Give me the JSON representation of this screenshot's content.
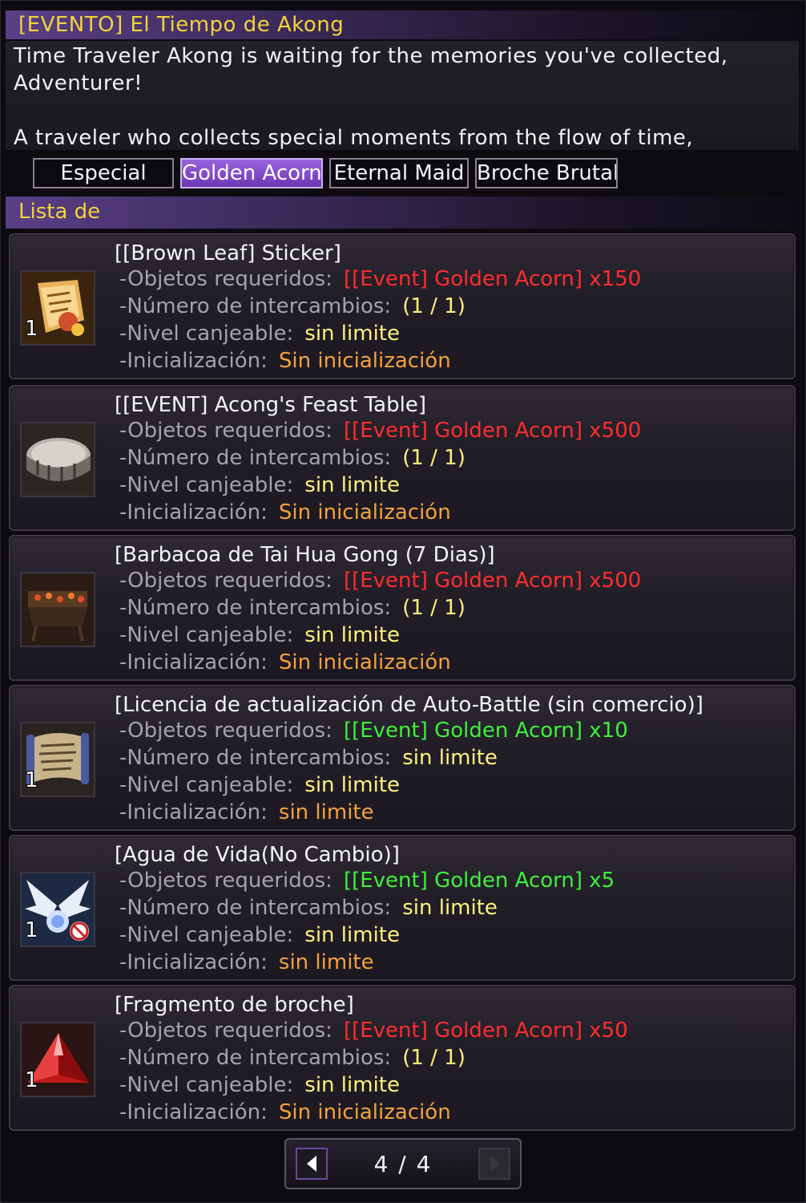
{
  "window": {
    "title": "[EVENTO] El Tiempo de Akong"
  },
  "description": {
    "line1": "Time Traveler Akong is waiting for the memories you've collected,",
    "line2": "Adventurer!",
    "line3": "",
    "line4": "A traveler who collects special moments from the flow of time,"
  },
  "tabs": [
    {
      "label": "Especial",
      "active": false
    },
    {
      "label": "Golden Acorn",
      "active": true
    },
    {
      "label": "Eternal Maid",
      "active": false
    },
    {
      "label": "Broche Brutal",
      "active": false
    }
  ],
  "list_header": "Lista de",
  "labels": {
    "required": "-Objetos requeridos:",
    "exchanges": "-Número de intercambios:",
    "level": "-Nivel canjeable:",
    "reset": "-Inicialización:"
  },
  "items": [
    {
      "name": "[[Brown Leaf] Sticker]",
      "icon": "scroll-sticker-icon",
      "qty": "1",
      "required": "[[Event] Golden Acorn] x150",
      "required_color": "#ff2d2d",
      "exchanges": "(1 / 1)",
      "level": "sin limite",
      "reset": "Sin inicialización"
    },
    {
      "name": "[[EVENT] Acong's Feast Table]",
      "icon": "feast-table-icon",
      "qty": "",
      "required": "[[Event] Golden Acorn] x500",
      "required_color": "#ff2d2d",
      "exchanges": "(1 / 1)",
      "level": "sin limite",
      "reset": "Sin inicialización"
    },
    {
      "name": "[Barbacoa de Tai Hua Gong (7 Dias)]",
      "icon": "barbecue-grill-icon",
      "qty": "",
      "required": "[[Event] Golden Acorn] x500",
      "required_color": "#ff2d2d",
      "exchanges": "(1 / 1)",
      "level": "sin limite",
      "reset": "Sin inicialización"
    },
    {
      "name": "[Licencia de actualización de Auto-Battle (sin comercio)]",
      "icon": "license-scroll-icon",
      "qty": "1",
      "required": "[[Event] Golden Acorn] x10",
      "required_color": "#3ef03a",
      "exchanges": "sin limite",
      "level": "sin limite",
      "reset": "sin limite"
    },
    {
      "name": "[Agua de Vida(No Cambio)]",
      "icon": "winged-potion-icon",
      "qty": "1",
      "required": "[[Event] Golden Acorn] x5",
      "required_color": "#3ef03a",
      "exchanges": "sin limite",
      "level": "sin limite",
      "reset": "sin limite"
    },
    {
      "name": "[Fragmento de broche]",
      "icon": "red-crystal-icon",
      "qty": "1",
      "required": "[[Event] Golden Acorn] x50",
      "required_color": "#ff2d2d",
      "exchanges": "(1 / 1)",
      "level": "sin limite",
      "reset": "Sin inicialización"
    }
  ],
  "pager": {
    "text": "4 / 4"
  }
}
